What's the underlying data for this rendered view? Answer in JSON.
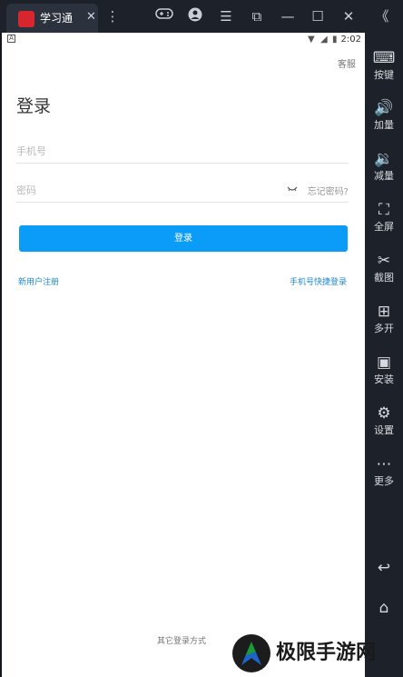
{
  "emulator": {
    "tab_title": "学习通",
    "tab_close": "✕",
    "toolbar_icons": {
      "more": "⋮",
      "gamepad": "🎮",
      "account": "●",
      "menu": "☰",
      "screen": "⧉",
      "minimize": "—",
      "maximize": "☐",
      "close": "✕",
      "collapse": "《"
    },
    "sidebar": [
      {
        "icon": "keyboard-icon",
        "glyph": "⌨",
        "label": "按键"
      },
      {
        "icon": "volume-up-icon",
        "glyph": "🔊",
        "label": "加量"
      },
      {
        "icon": "volume-down-icon",
        "glyph": "🔉",
        "label": "减量"
      },
      {
        "icon": "fullscreen-icon",
        "glyph": "⛶",
        "label": "全屏"
      },
      {
        "icon": "scissors-icon",
        "glyph": "✂",
        "label": "截图"
      },
      {
        "icon": "multi-instance-icon",
        "glyph": "⊞",
        "label": "多开"
      },
      {
        "icon": "apk-icon",
        "glyph": "▣",
        "label": "安装"
      },
      {
        "icon": "gear-icon",
        "glyph": "⚙",
        "label": "设置"
      },
      {
        "icon": "more-icon",
        "glyph": "⋯",
        "label": "更多"
      }
    ],
    "nav": {
      "back_glyph": "↩",
      "home_glyph": "⌂"
    }
  },
  "statusbar": {
    "time": "2:02"
  },
  "login": {
    "service_link": "客服",
    "title": "登录",
    "phone_placeholder": "手机号",
    "password_placeholder": "密码",
    "forgot": "忘记密码?",
    "button": "登录",
    "register": "新用户注册",
    "quick_login": "手机号快捷登录",
    "other_methods": "其它登录方式"
  },
  "watermark": {
    "text": "极限手游网"
  },
  "colors": {
    "primary": "#0a9cf7",
    "link": "#1f88d8",
    "emulator_bg": "#1d2129"
  }
}
